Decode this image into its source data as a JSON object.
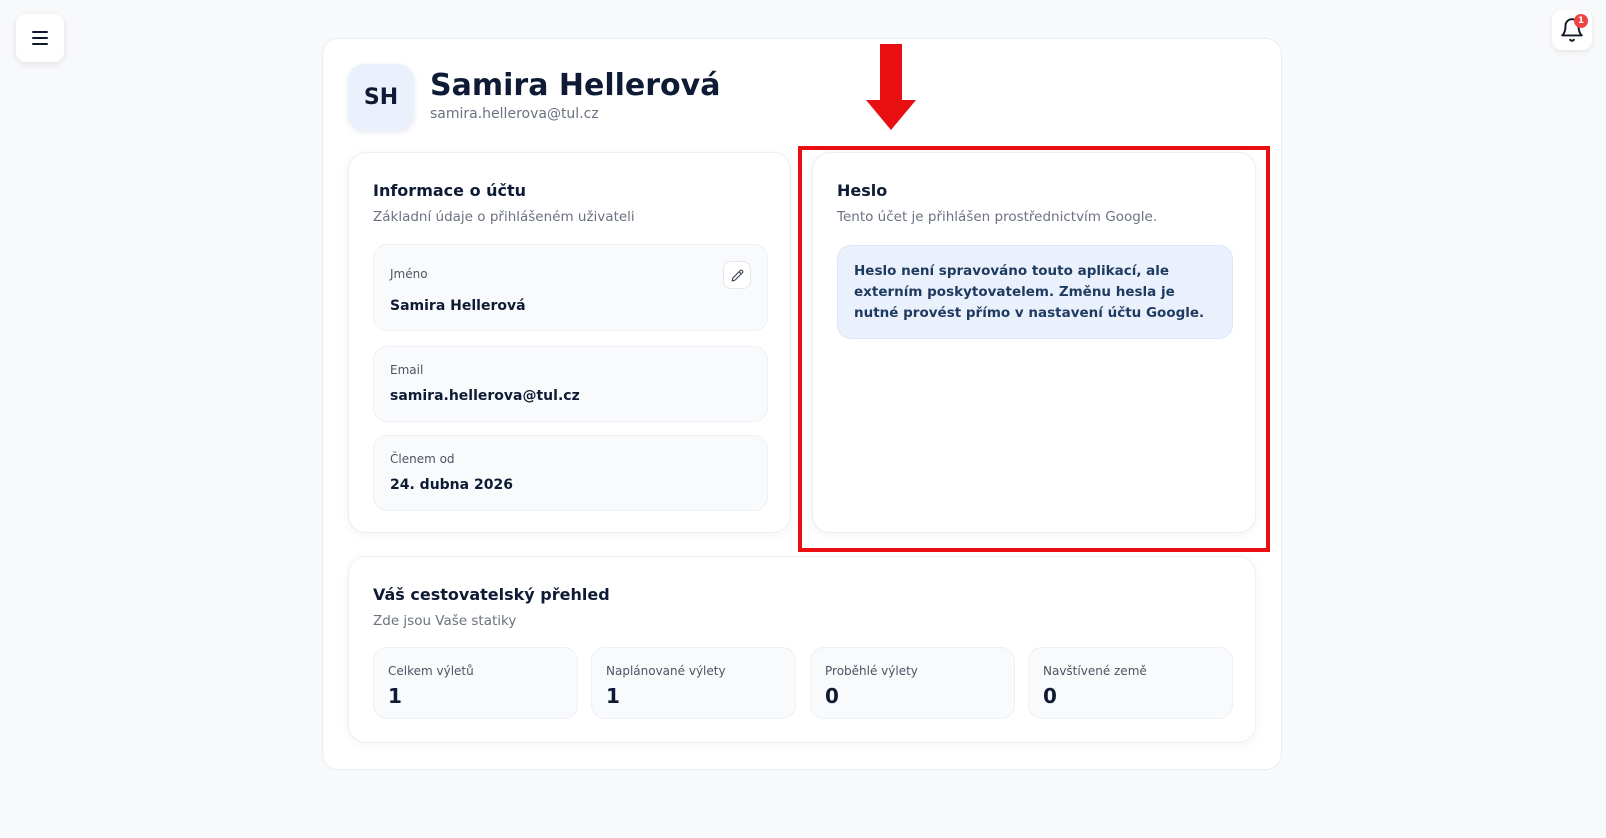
{
  "topbar": {
    "menu_icon": "hamburger-icon",
    "bell_icon": "bell-icon",
    "notification_count": "1"
  },
  "profile": {
    "initials": "SH",
    "name": "Samira Hellerová",
    "email": "samira.hellerova@tul.cz"
  },
  "account_info": {
    "title": "Informace o účtu",
    "subtitle": "Základní údaje o přihlášeném uživateli",
    "fields": [
      {
        "label": "Jméno",
        "value": "Samira Hellerová",
        "editable": true,
        "edit_icon": "pencil-icon"
      },
      {
        "label": "Email",
        "value": "samira.hellerova@tul.cz"
      },
      {
        "label": "Členem od",
        "value": "24. dubna 2026"
      }
    ]
  },
  "password": {
    "title": "Heslo",
    "subtitle": "Tento účet je přihlášen prostřednictvím Google.",
    "notice": "Heslo není spravováno touto aplikací, ale externím poskytovatelem. Změnu hesla je nutné provést přímo v nastavení účtu Google."
  },
  "stats": {
    "title": "Váš cestovatelský přehled",
    "subtitle": "Zde jsou Vaše statiky",
    "items": [
      {
        "label": "Celkem výletů",
        "value": "1"
      },
      {
        "label": "Naplánované výlety",
        "value": "1"
      },
      {
        "label": "Proběhlé výlety",
        "value": "0"
      },
      {
        "label": "Navštívené země",
        "value": "0"
      }
    ]
  },
  "annotation": {
    "color": "#e80e12",
    "arrow_icon": "down-arrow-icon"
  }
}
